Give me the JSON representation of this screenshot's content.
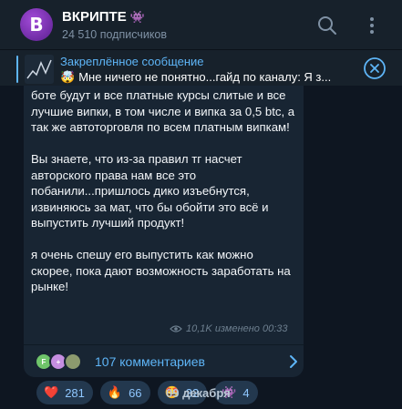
{
  "header": {
    "avatar_letter": "B",
    "title": "ВКРИПТЕ",
    "title_emoji": "👾",
    "subscribers": "24 510 подписчиков",
    "icons": [
      "search-icon",
      "more-vertical-icon"
    ]
  },
  "pinned": {
    "label": "Закреплённое сообщение",
    "emoji": "🤯",
    "text": "Мне ничего не понятно...гайд по каналу:   Я з..."
  },
  "message": {
    "text": "боте будут и все платные курсы слитые и все лучшие випки, в том числе и випка за 0,5 btc, а так же автоторговля по всем платным випкам!\n\n Вы знаете, что из-за правил тг насчет авторского права нам все это побанили...пришлось дико изъебнутся, извиняюсь за мат, что бы обойти это всё и выпустить лучший продукт!\n\n я очень спешу его выпустить как можно скорее, пока дают возможность заработать на рынке!",
    "reactions": [
      {
        "emoji": "❤️",
        "count": "281"
      },
      {
        "emoji": "🔥",
        "count": "66"
      },
      {
        "emoji": "🤩",
        "count": "32"
      },
      {
        "emoji": "👾",
        "count": "4"
      }
    ],
    "views": "10,1K",
    "edited_time": "изменено 00:33",
    "comments_label": "107 комментариев",
    "commenter_avatars": [
      "F",
      "+",
      ""
    ]
  },
  "date_separator": "09 декабря",
  "colors": {
    "accent": "#5eb5f7",
    "background": "#0e1621",
    "bubble": "#182533",
    "header": "#17212b"
  }
}
